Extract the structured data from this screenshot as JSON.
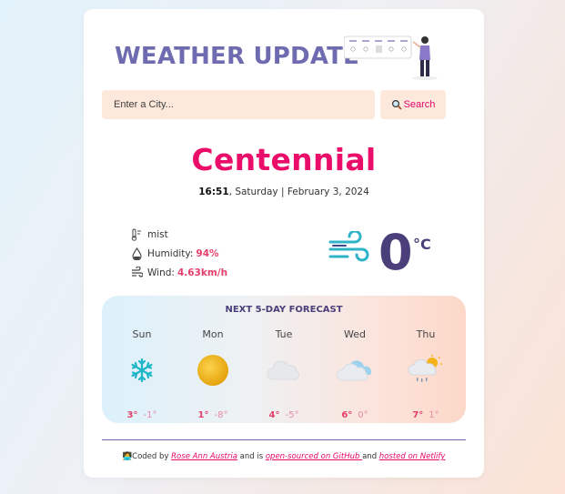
{
  "header": {
    "title": "WEATHER UPDATE"
  },
  "search": {
    "placeholder": "Enter a City...",
    "button_label": "Search"
  },
  "current": {
    "city": "Centennial",
    "time": "16:51",
    "date_rest": ", Saturday | February 3, 2024",
    "description": "mist",
    "humidity_label": "Humidity:",
    "humidity_value": "94%",
    "wind_label": "Wind:",
    "wind_value": "4.63km/h",
    "temperature": "0",
    "unit": "°C"
  },
  "forecast": {
    "title": "NEXT 5-DAY FORECAST",
    "days": [
      {
        "name": "Sun",
        "icon": "snowflake-icon",
        "hi": "3°",
        "lo": "-1°"
      },
      {
        "name": "Mon",
        "icon": "sun-icon",
        "hi": "1°",
        "lo": "-8°"
      },
      {
        "name": "Tue",
        "icon": "cloud-icon",
        "hi": "4°",
        "lo": "-5°"
      },
      {
        "name": "Wed",
        "icon": "cloud-sky-icon",
        "hi": "6°",
        "lo": "0°"
      },
      {
        "name": "Thu",
        "icon": "rain-sun-cloud-icon",
        "hi": "7°",
        "lo": "1°"
      }
    ]
  },
  "footer": {
    "emoji": "👩‍💻",
    "prefix": "Coded by ",
    "author": "Rose Ann Austria",
    "middle": " and is ",
    "source_link": "open-sourced on GitHub ",
    "and": "and ",
    "host_link": "hosted on Netlify"
  }
}
